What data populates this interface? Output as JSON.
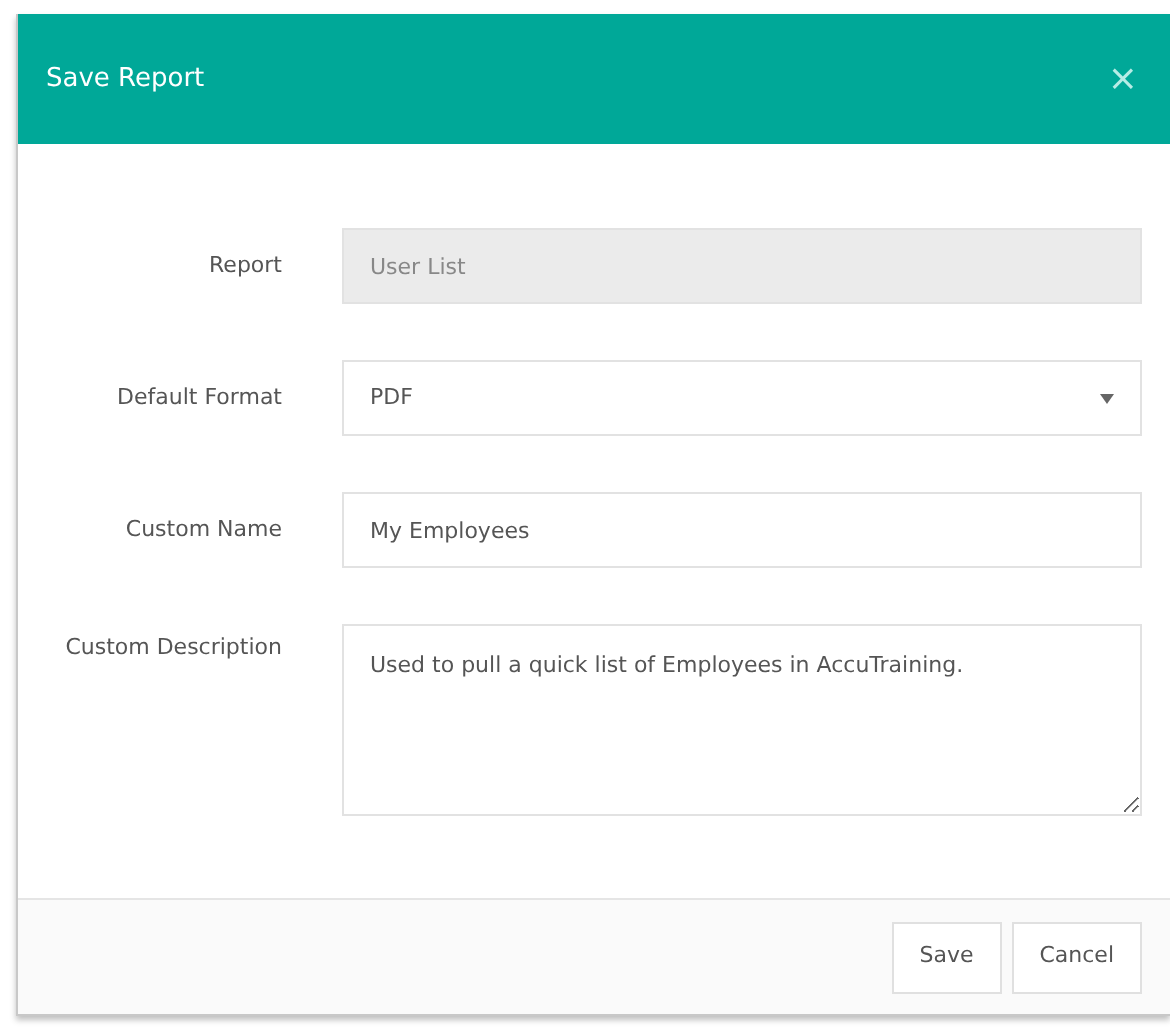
{
  "dialog": {
    "title": "Save Report",
    "close": "×"
  },
  "fields": [
    {
      "label": "Report",
      "kind": "text",
      "value": "User List",
      "disabled": true
    },
    {
      "label": "Default Format",
      "kind": "select",
      "value": "PDF",
      "disabled": false
    },
    {
      "label": "Custom Name",
      "kind": "text",
      "value": "My Employees",
      "disabled": false
    },
    {
      "label": "Custom Description",
      "kind": "textarea",
      "value": "Used to pull a quick list of Employees in AccuTraining.",
      "disabled": false
    }
  ],
  "buttons": [
    "Save",
    "Cancel"
  ]
}
